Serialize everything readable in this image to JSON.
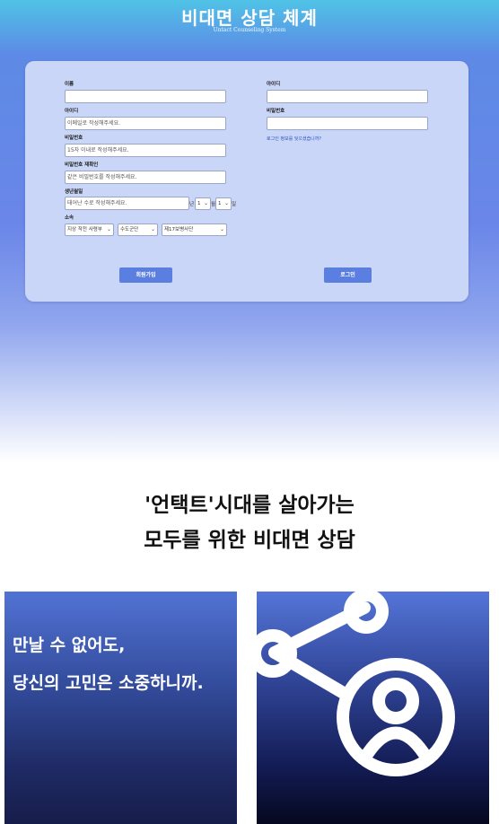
{
  "header": {
    "title": "비대면 상담 체계",
    "subtitle": "Untact Counseling System"
  },
  "signup": {
    "name_label": "이름",
    "id_label": "아이디",
    "id_placeholder": "이메일로 작성해주세요.",
    "pw_label": "비밀번호",
    "pw_placeholder": "15자 이내로 작성해주세요.",
    "pw_confirm_label": "비밀번호 재확인",
    "pw_confirm_placeholder": "같은 비밀번호를 작성해주세요.",
    "birth_label": "생년월일",
    "birth_placeholder": "태어난 수로 작성해주세요.",
    "year_suffix": "년",
    "month_value": "1",
    "month_suffix": "월",
    "day_value": "1",
    "day_suffix": "일",
    "affiliation_label": "소속",
    "affiliation_options": [
      "지상 작전 사령부",
      "수도군단",
      "제17보병사단"
    ],
    "submit_label": "회원가입"
  },
  "login": {
    "id_label": "아이디",
    "pw_label": "비밀번호",
    "forgot_link": "로그인 정보를 잊으셨습니까?",
    "submit_label": "로그인"
  },
  "slogan": {
    "line1": "'언택트'시대를 살아가는",
    "line2": "모두를 위한 비대면 상담"
  },
  "panel": {
    "line1": "만날 수 없어도,",
    "line2": "당신의 고민은 소중하니까."
  },
  "icons": [
    "chevron-down-icon",
    "share-user-icon"
  ],
  "colors": {
    "accent": "#5b7fe0",
    "card": "#c9d6f7",
    "hero_top": "#4fc3e6",
    "panel_dark": "#171d4a"
  }
}
